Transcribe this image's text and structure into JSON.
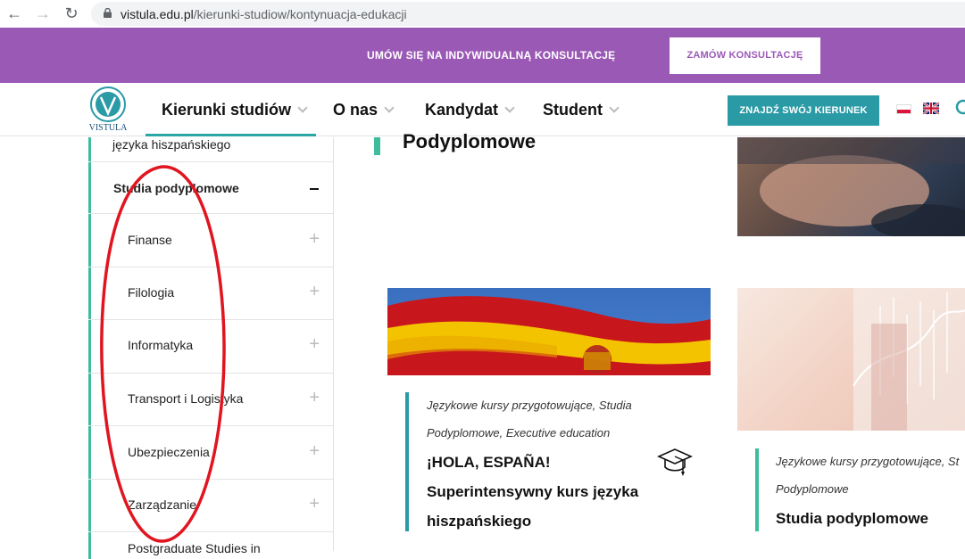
{
  "browser": {
    "url_domain": "vistula.edu.pl",
    "url_path": "/kierunki-studiow/kontynuacja-edukacji"
  },
  "banner": {
    "text": "UMÓW SIĘ NA INDYWIDUALNĄ KONSULTACJĘ",
    "button": "ZAMÓW KONSULTACJĘ"
  },
  "header": {
    "logo_text": "VISTULA",
    "nav": [
      {
        "label": "Kierunki studiów"
      },
      {
        "label": "O nas"
      },
      {
        "label": "Kandydat"
      },
      {
        "label": "Student"
      }
    ],
    "cta": "ZNAJDŹ SWÓJ KIERUNEK",
    "languages": [
      "pl",
      "en"
    ]
  },
  "sidebar": {
    "partial_item": "języka hiszpańskiego",
    "section": "Studia podyplomowe",
    "items": [
      {
        "label": "Finanse"
      },
      {
        "label": "Filologia"
      },
      {
        "label": "Informatyka"
      },
      {
        "label": "Transport i Logistyka"
      },
      {
        "label": "Ubezpieczenia"
      },
      {
        "label": "Zarządzanie"
      },
      {
        "label": "Postgraduate Studies in"
      }
    ]
  },
  "main": {
    "section_title": "Podyplomowe",
    "cards": [
      {
        "tags_line1": "Językowe kursy przygotowujące, Studia",
        "tags_line2": "Podyplomowe, Executive education",
        "title_line1": "¡HOLA, ESPAÑA!",
        "title_line2": "Superintensywny kurs języka",
        "title_line3": "hiszpańskiego",
        "icon": "graduation-cap-icon"
      },
      {
        "tags_line1": "Językowe kursy przygotowujące, St",
        "tags_line2": "Podyplomowe",
        "title_line1": "Studia podyplomowe"
      }
    ]
  },
  "colors": {
    "banner": "#9b59b6",
    "accent_teal": "#2a9aa5",
    "accent_green": "#3dbd9c",
    "annotation": "#e0151f"
  }
}
